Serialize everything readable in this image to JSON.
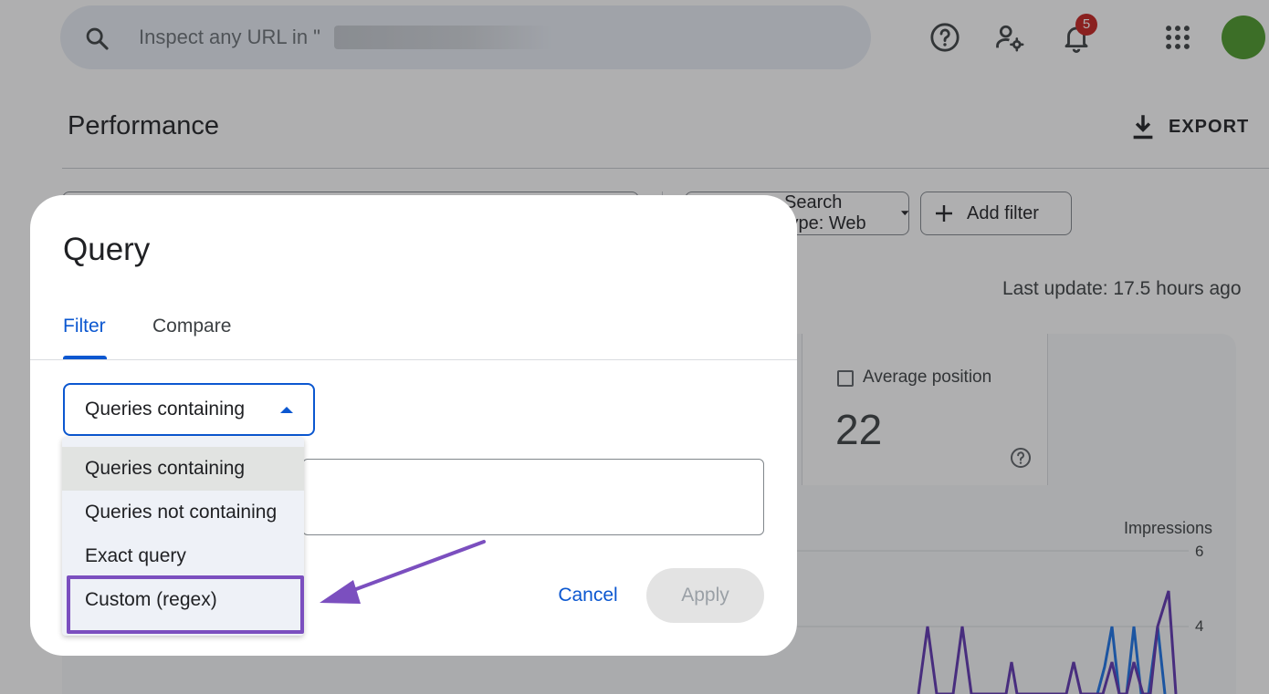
{
  "search": {
    "placeholder": "Inspect any URL in \""
  },
  "header": {
    "help_icon": "help-circle-icon",
    "account_settings_icon": "manage-accounts-icon",
    "notifications_icon": "bell-icon",
    "notifications_count": "5",
    "apps_icon": "apps-grid-icon"
  },
  "page": {
    "title": "Performance",
    "export_label": "EXPORT"
  },
  "filters": {
    "search_type_label": "Search type: Web",
    "add_filter_label": "Add filter"
  },
  "status": {
    "last_update": "Last update: 17.5 hours ago"
  },
  "metrics": {
    "average_position_label": "Average position",
    "average_position_value": "22"
  },
  "chart": {
    "impressions_label": "Impressions",
    "tick_6": "6",
    "tick_4": "4"
  },
  "dialog": {
    "title": "Query",
    "tabs": [
      {
        "label": "Filter",
        "active": true
      },
      {
        "label": "Compare",
        "active": false
      }
    ],
    "select_value": "Queries containing",
    "options": [
      "Queries containing",
      "Queries not containing",
      "Exact query",
      "Custom (regex)"
    ],
    "cancel_label": "Cancel",
    "apply_label": "Apply"
  },
  "colors": {
    "accent": "#0b57d0",
    "annotation": "#7b4fbf",
    "badge": "#c5221f",
    "avatar": "#4c9a2a"
  }
}
